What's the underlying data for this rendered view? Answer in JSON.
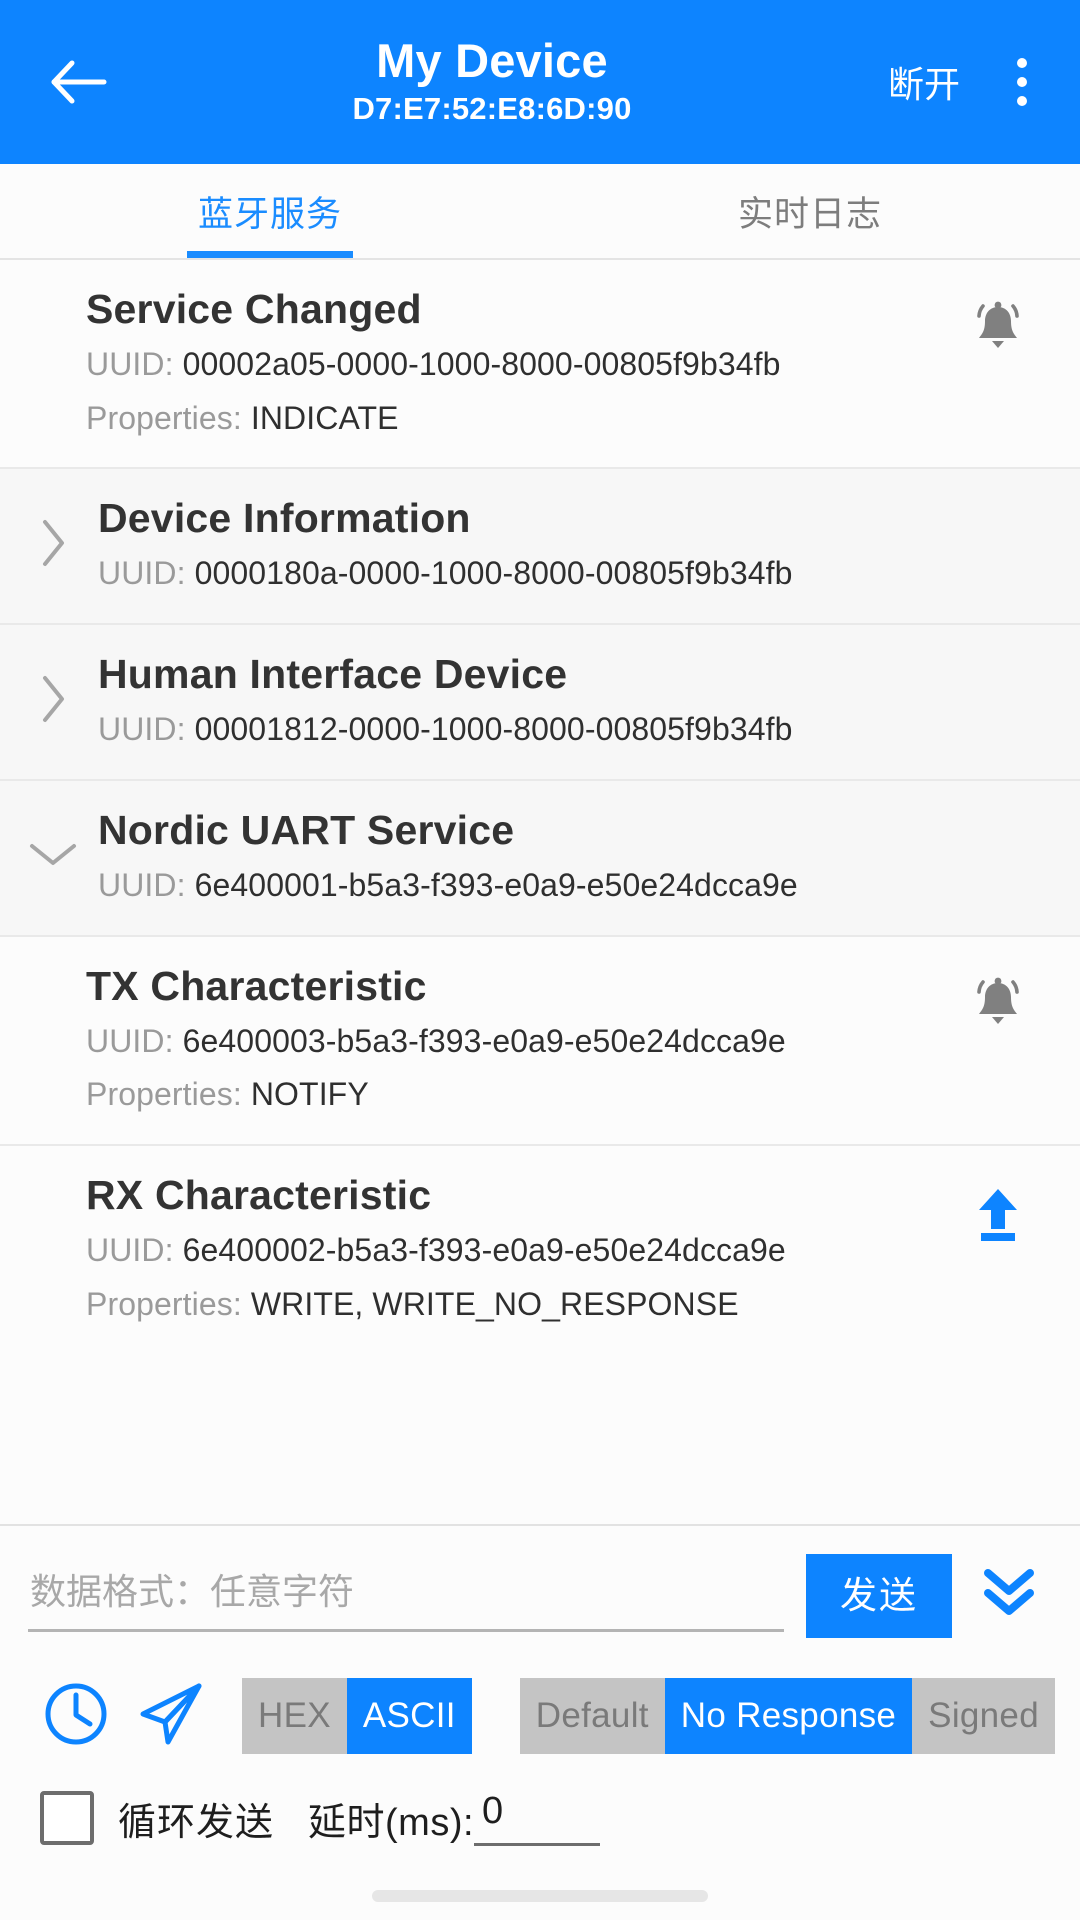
{
  "appbar": {
    "back_icon": "arrow-left-icon",
    "title": "My Device",
    "subtitle": "D7:E7:52:E8:6D:90",
    "disconnect_label": "断开",
    "overflow_icon": "more-vertical-icon",
    "bg_color": "#0d84ff"
  },
  "tabs": [
    {
      "label": "蓝牙服务",
      "active": true
    },
    {
      "label": "实时日志",
      "active": false
    }
  ],
  "accent_color": "#0d84ff",
  "labels": {
    "uuid_prefix": "UUID:",
    "properties_prefix": "Properties:"
  },
  "list": [
    {
      "kind": "characteristic",
      "name": "Service Changed",
      "uuid": "00002a05-0000-1000-8000-00805f9b34fb",
      "properties": "INDICATE",
      "action_icon": "bell-ring-icon",
      "chevron": null
    },
    {
      "kind": "service",
      "name": "Device Information",
      "uuid": "0000180a-0000-1000-8000-00805f9b34fb",
      "properties": null,
      "action_icon": null,
      "chevron": "chevron-right-icon"
    },
    {
      "kind": "service",
      "name": "Human Interface Device",
      "uuid": "00001812-0000-1000-8000-00805f9b34fb",
      "properties": null,
      "action_icon": null,
      "chevron": "chevron-right-icon"
    },
    {
      "kind": "service",
      "name": "Nordic UART Service",
      "uuid": "6e400001-b5a3-f393-e0a9-e50e24dcca9e",
      "properties": null,
      "action_icon": null,
      "chevron": "chevron-down-icon"
    },
    {
      "kind": "characteristic",
      "name": "TX Characteristic",
      "uuid": "6e400003-b5a3-f393-e0a9-e50e24dcca9e",
      "properties": "NOTIFY",
      "action_icon": "bell-ring-icon",
      "chevron": null
    },
    {
      "kind": "characteristic",
      "name": "RX Characteristic",
      "uuid": "6e400002-b5a3-f393-e0a9-e50e24dcca9e",
      "properties": "WRITE, WRITE_NO_RESPONSE",
      "action_icon": "upload-icon",
      "chevron": null
    }
  ],
  "send_panel": {
    "input_value": "",
    "input_placeholder": "数据格式：任意字符",
    "send_label": "发送",
    "expand_icon": "chevron-double-down-icon",
    "history_icon": "clock-icon",
    "quick_send_icon": "paper-plane-icon",
    "format_segments": [
      {
        "label": "HEX",
        "selected": false
      },
      {
        "label": "ASCII",
        "selected": true
      }
    ],
    "write_segments": [
      {
        "label": "Default",
        "selected": false
      },
      {
        "label": "No Response",
        "selected": true
      },
      {
        "label": "Signed",
        "selected": false
      }
    ],
    "loop_send_label": "循环发送",
    "loop_send_checked": false,
    "delay_label": "延时(ms):",
    "delay_value": "0"
  }
}
